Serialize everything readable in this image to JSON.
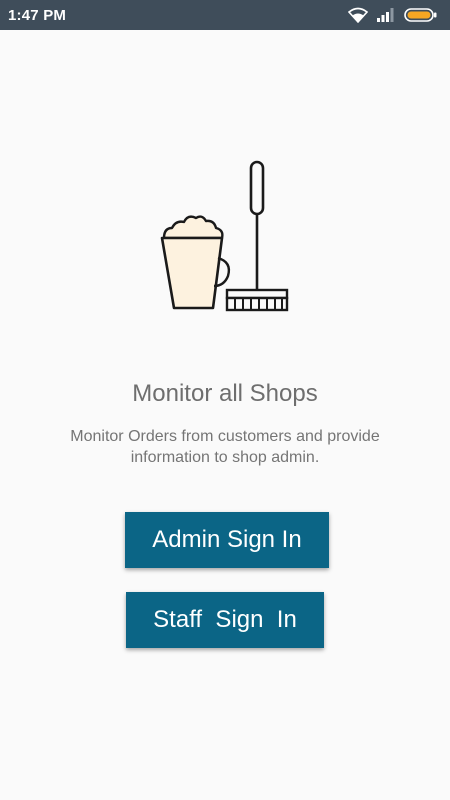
{
  "status_bar": {
    "time": "1:47 PM",
    "icons": [
      "wifi-icon",
      "signal-icon",
      "battery-icon"
    ],
    "background": "#3f4d5a",
    "battery_color": "#f5a623"
  },
  "illustration": {
    "icons": [
      "bucket-icon",
      "broom-icon"
    ],
    "bucket_fill": "#fdf2df",
    "line_color": "#1a1a1a"
  },
  "onboarding": {
    "title": "Monitor all Shops",
    "description": "Monitor Orders from customers and provide information to shop admin."
  },
  "actions": {
    "admin_sign_in": "Admin Sign In",
    "staff_sign_in": "Staff  Sign  In",
    "button_color": "#0b6586"
  }
}
